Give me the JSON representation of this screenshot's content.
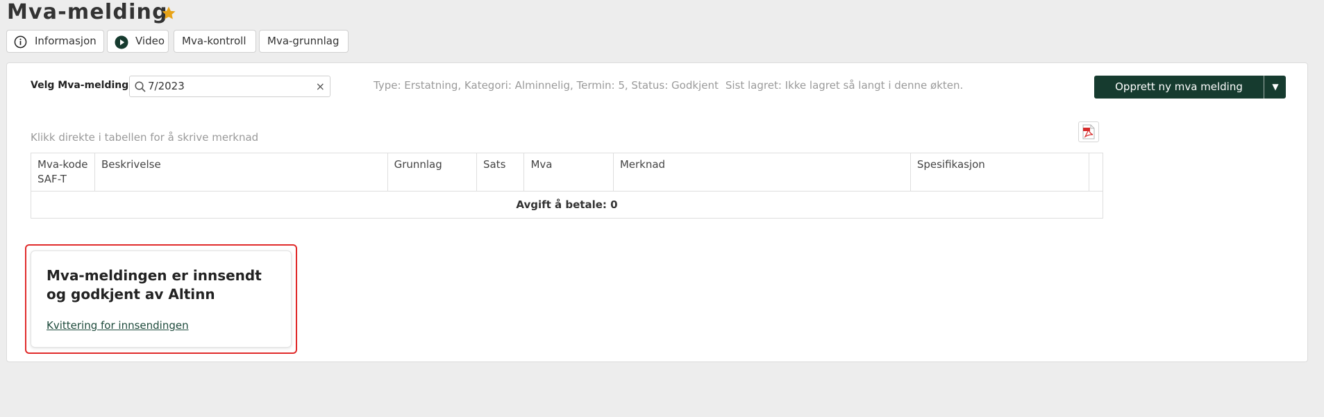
{
  "page": {
    "title": "Mva-melding",
    "favorite_icon": "star-icon",
    "accent_color": "#e8a317"
  },
  "tabs": [
    {
      "label": "Informasjon",
      "icon": "info-icon"
    },
    {
      "label": "Video",
      "icon": "play-icon"
    },
    {
      "label": "Mva-kontroll"
    },
    {
      "label": "Mva-grunnlag"
    }
  ],
  "toolbar": {
    "select_label": "Velg Mva-melding:",
    "search_value": "7/2023",
    "search_icon": "search-icon",
    "clear_icon": "close-icon",
    "status": "Type: Erstatning, Kategori: Alminnelig, Termin: 5, Status: Godkjent",
    "saved": "Sist lagret: Ikke lagret så langt i denne økten.",
    "create_button": "Opprett ny mva melding",
    "create_button_color": "#163b2f",
    "dropdown_icon": "caret-down-icon"
  },
  "table": {
    "hint": "Klikk direkte i tabellen for å skrive merknad",
    "pdf_icon": "pdf-icon",
    "columns": [
      "Mva-kode SAF-T",
      "Beskrivelse",
      "Grunnlag",
      "Sats",
      "Mva",
      "Merknad",
      "Spesifikasjon"
    ],
    "rows": [],
    "total": "Avgift å betale: 0"
  },
  "notice": {
    "title": "Mva-meldingen er innsendt og godkjent av Altinn",
    "link": "Kvittering for innsendingen",
    "highlight_color": "#e02a2a"
  }
}
